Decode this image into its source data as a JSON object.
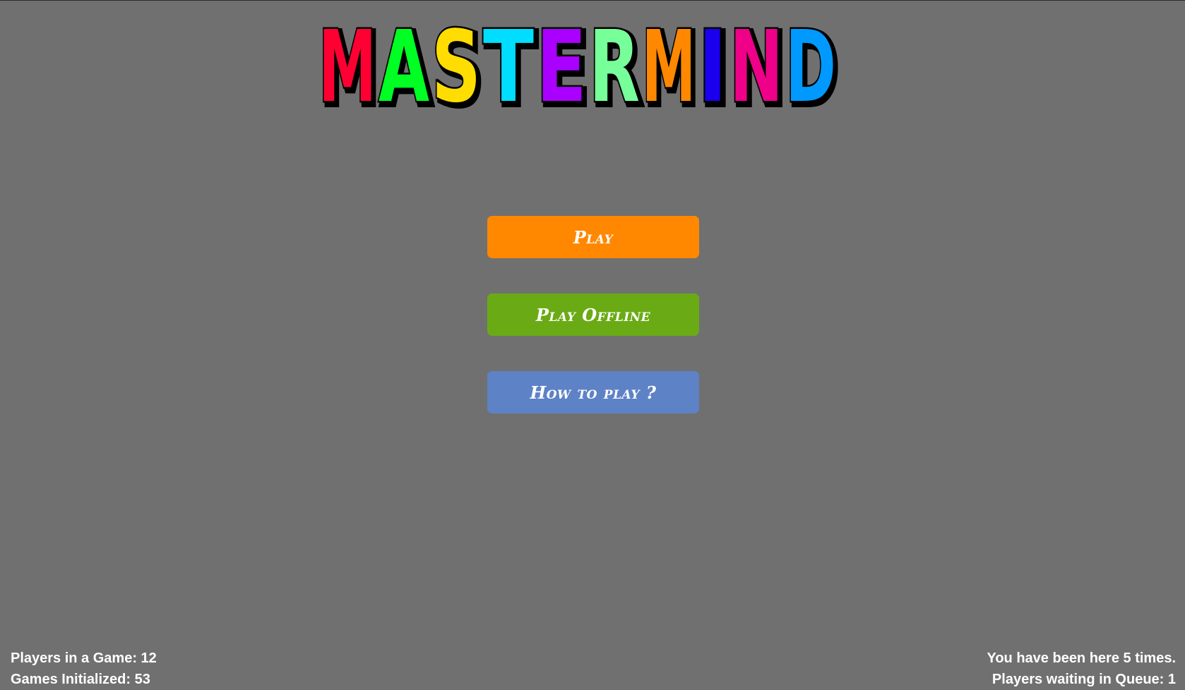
{
  "logo": {
    "letters": [
      {
        "char": "M",
        "color": "#ff0033"
      },
      {
        "char": "A",
        "color": "#00ff22"
      },
      {
        "char": "S",
        "color": "#ffdd00"
      },
      {
        "char": "T",
        "color": "#00ddff"
      },
      {
        "char": "E",
        "color": "#aa00ff"
      },
      {
        "char": "R",
        "color": "#77ff99"
      },
      {
        "char": "M",
        "color": "#ff8800"
      },
      {
        "char": "I",
        "color": "#1a00ee"
      },
      {
        "char": "N",
        "color": "#ee0088"
      },
      {
        "char": "D",
        "color": "#0099ff"
      }
    ]
  },
  "menu": {
    "play_label": "Play",
    "offline_label": "Play Offline",
    "howto_label": "How to play ?"
  },
  "stats": {
    "players_in_game": "Players in a Game: 12",
    "games_initialized": "Games Initialized: 53",
    "visits": "You have been here 5 times.",
    "queue": "Players waiting in Queue: 1"
  },
  "colors": {
    "background": "#707070",
    "play": "#ff8800",
    "offline": "#6aab15",
    "howto": "#5e82c6"
  }
}
